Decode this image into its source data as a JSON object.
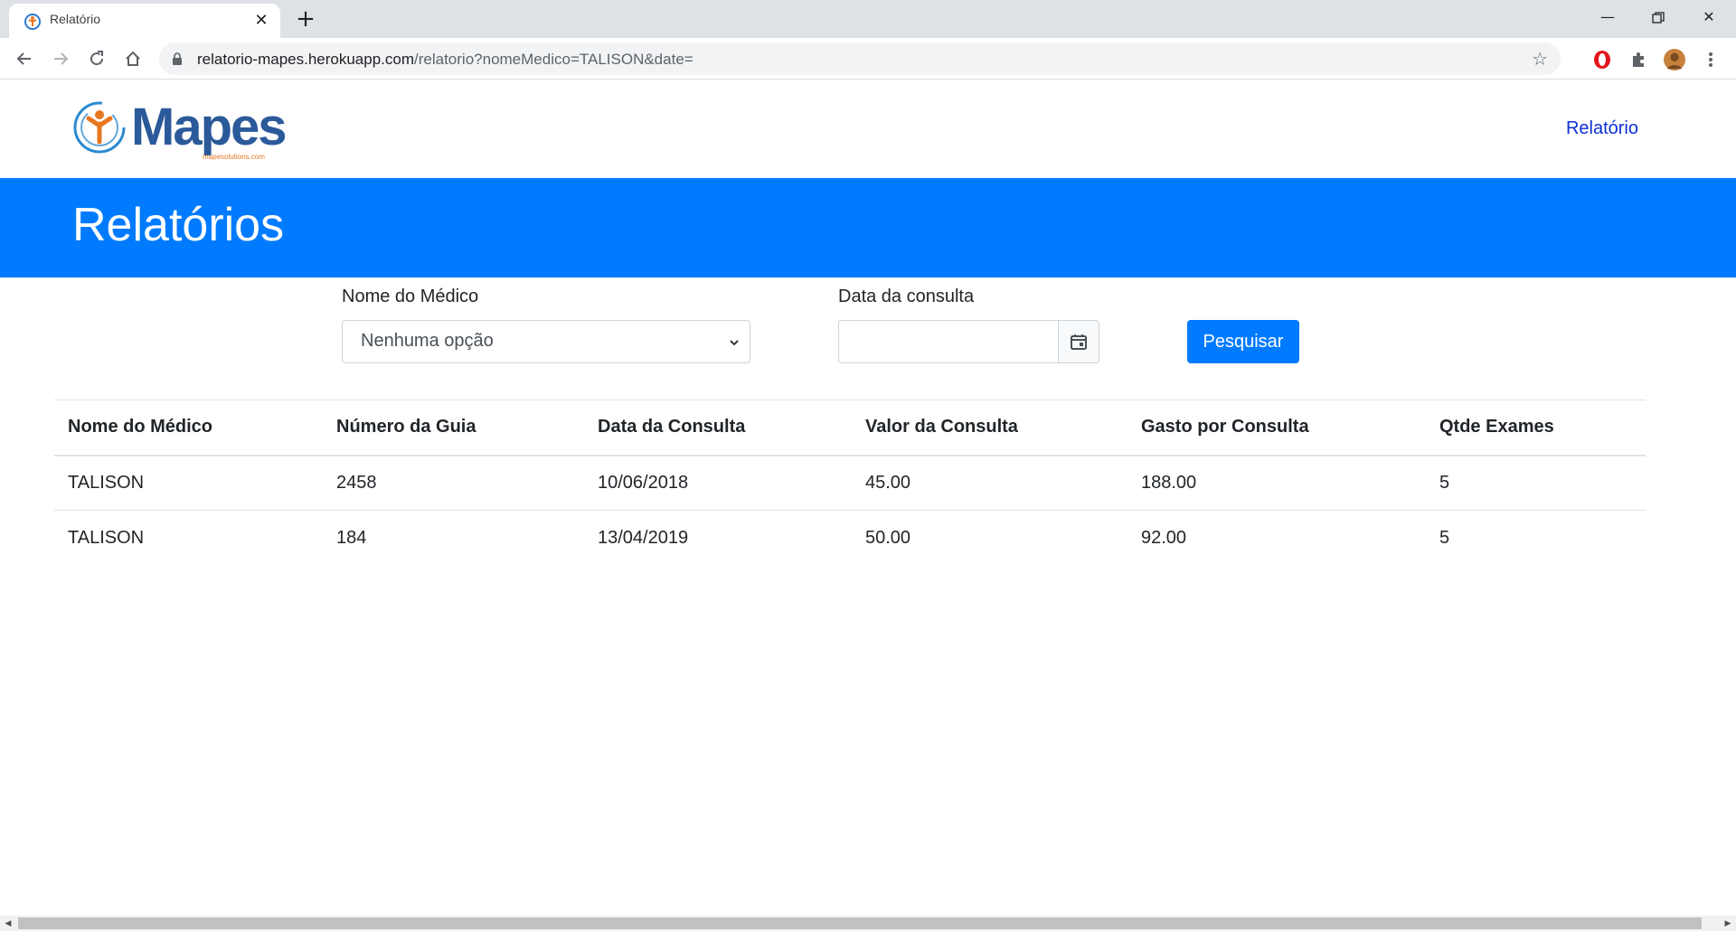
{
  "browser": {
    "tab_title": "Relatório",
    "url_host": "relatorio-mapes.herokuapp.com",
    "url_path": "/relatorio?nomeMedico=TALISON&date="
  },
  "navbar": {
    "logo_text": "Mapes",
    "logo_sub": "mapesolutions.com",
    "link_label": "Relatório"
  },
  "header": {
    "title": "Relatórios"
  },
  "form": {
    "doctor_label": "Nome do Médico",
    "doctor_selected": "Nenhuma opção",
    "date_label": "Data da consulta",
    "date_value": "",
    "search_label": "Pesquisar"
  },
  "table": {
    "columns": [
      "Nome do Médico",
      "Número da Guia",
      "Data da Consulta",
      "Valor da Consulta",
      "Gasto por Consulta",
      "Qtde Exames"
    ],
    "rows": [
      [
        "TALISON",
        "2458",
        "10/06/2018",
        "45.00",
        "188.00",
        "5"
      ],
      [
        "TALISON",
        "184",
        "13/04/2019",
        "50.00",
        "92.00",
        "5"
      ]
    ]
  },
  "colors": {
    "primary": "#007bff",
    "nav_link": "#0d2fd4",
    "logo_blue": "#2b5a9a",
    "logo_orange": "#e87722"
  }
}
